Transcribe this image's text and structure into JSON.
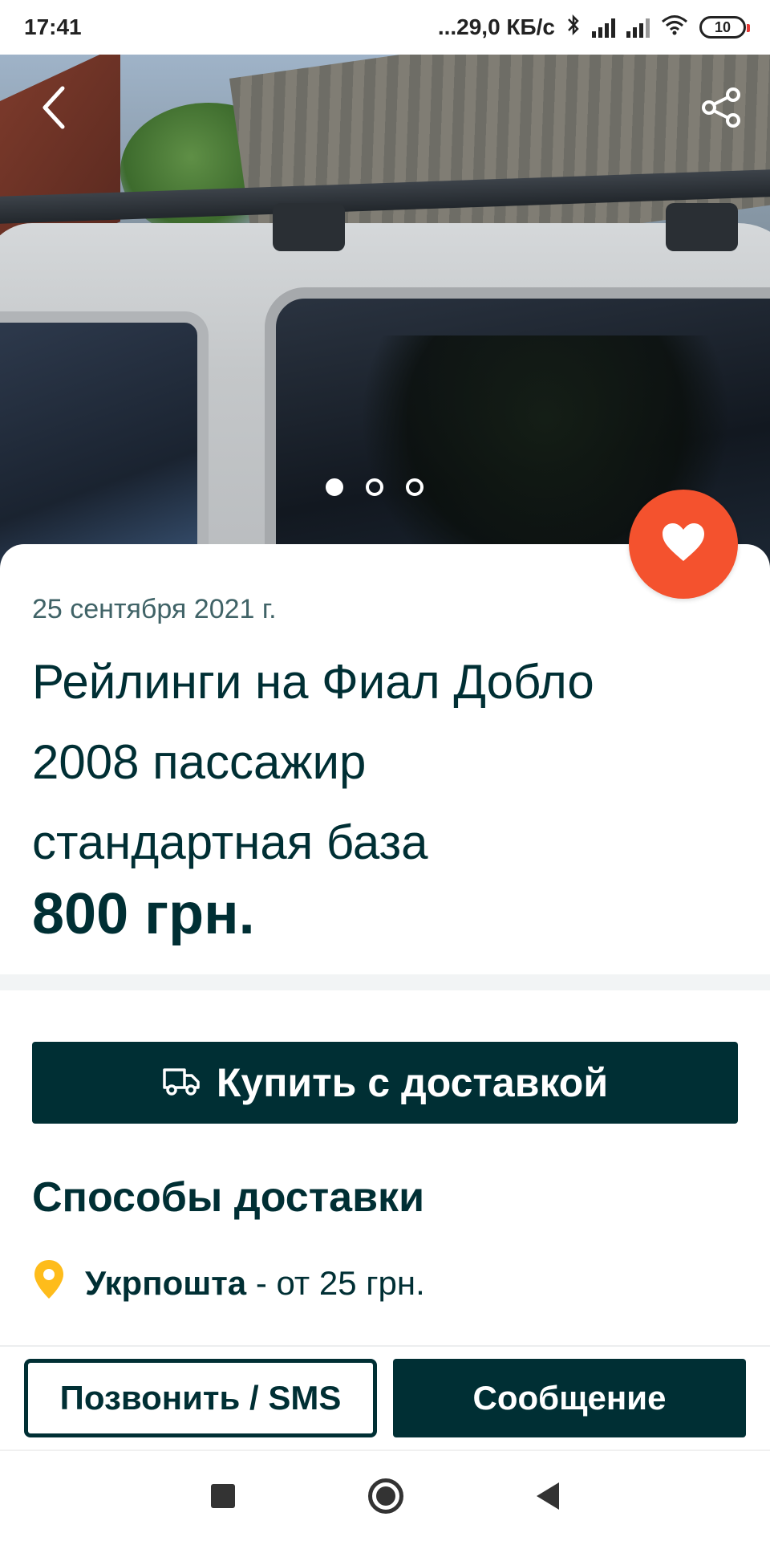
{
  "status_bar": {
    "time": "17:41",
    "network_speed": "...29,0 КБ/с",
    "battery_level": "10",
    "icons": [
      "bluetooth-icon",
      "signal-icon",
      "signal-icon",
      "wifi-icon",
      "battery-icon"
    ]
  },
  "gallery": {
    "image_count": 3,
    "active_index": 0,
    "icons": {
      "back": "arrow-left-icon",
      "share": "share-icon"
    }
  },
  "listing": {
    "date": "25 сентября 2021 г.",
    "title": "Рейлинги на Фиал Добло 2008 пассажир стандартная база",
    "price": "800 грн."
  },
  "favorite": {
    "icon": "heart-icon",
    "color": "#f4522e"
  },
  "buy_button": {
    "label": "Купить с доставкой",
    "icon": "truck-icon"
  },
  "delivery": {
    "title": "Способы доставки",
    "options": [
      {
        "name": "Укрпошта",
        "price": " - от 25 грн.",
        "icon": "location-pin-icon"
      }
    ]
  },
  "actions": {
    "call_label": "Позвонить / SMS",
    "message_label": "Сообщение"
  },
  "colors": {
    "primary": "#002f34",
    "accent": "#f4522e",
    "pin": "#febc1b"
  }
}
